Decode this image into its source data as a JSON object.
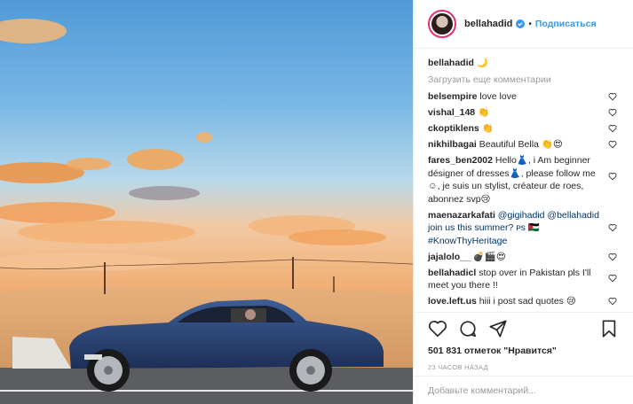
{
  "header": {
    "username": "bellahadid",
    "separator": "•",
    "follow_label": "Подписаться"
  },
  "caption": {
    "username": "bellahadid",
    "text": "🌙"
  },
  "load_more_label": "Загрузить еще комментарии",
  "comments": [
    {
      "user": "belsempire",
      "text": "love love"
    },
    {
      "user": "vishal_148",
      "text": "👏"
    },
    {
      "user": "ckoptiklens",
      "text": "👏"
    },
    {
      "user": "nikhilbagai",
      "text": "Beautiful Bella 👏😍"
    },
    {
      "user": "fares_ben2002",
      "text": "Hello👗, i Am beginner désigner of dresses👗, please follow me☺, je suis un stylist, créateur de roes, abonnez svp😢"
    },
    {
      "user": "maenazarkafati",
      "text": "@gigihadid @bellahadid join us this summer? ᴘs 🇯🇴 #KnowThyHeritage"
    },
    {
      "user": "jajalolo__",
      "text": "💣🎬😍"
    },
    {
      "user": "bellahadicl",
      "text": "stop over in Pakistan pls I'll meet you there !!"
    },
    {
      "user": "love.left.us",
      "text": "hiii i post sad quotes 😢"
    }
  ],
  "likes_text": "501 831 отметок \"Нравится\"",
  "time_text": "23 часов назад",
  "add_comment_placeholder": "Добавьте комментарий...",
  "colors": {
    "follow": "#3897f0",
    "text": "#262626",
    "muted": "#999999",
    "border": "#efefef"
  },
  "icons": [
    "heart-icon",
    "comment-icon",
    "share-icon",
    "bookmark-icon",
    "verified-icon"
  ]
}
